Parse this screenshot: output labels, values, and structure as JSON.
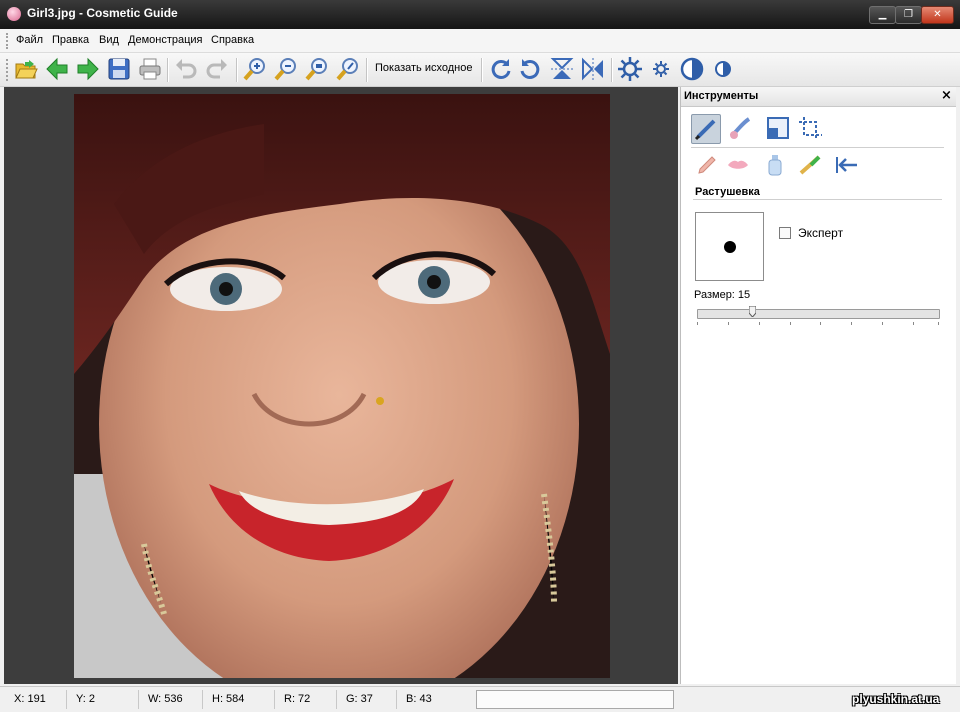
{
  "window": {
    "title": "Girl3.jpg - Cosmetic Guide"
  },
  "menu": [
    "Файл",
    "Правка",
    "Вид",
    "Демонстрация",
    "Справка"
  ],
  "toolbar": {
    "show_original_label": "Показать исходное",
    "icons": [
      "open-icon",
      "back-arrow-icon",
      "forward-arrow-icon",
      "save-icon",
      "print-icon",
      "undo-icon",
      "redo-icon",
      "zoom-in-icon",
      "zoom-out-icon",
      "zoom-fit-icon",
      "zoom-actual-icon",
      "rotate-cw-icon",
      "rotate-ccw-icon",
      "flip-vertical-icon",
      "flip-horizontal-icon",
      "brightness-increase-icon",
      "brightness-decrease-icon",
      "contrast-icon",
      "contrast-small-icon"
    ]
  },
  "tools_panel": {
    "title": "Инструменты",
    "close_label": "×",
    "top_tools": [
      "brush-icon",
      "magic-brush-icon",
      "resize-icon",
      "crop-icon"
    ],
    "second_tools": [
      "pencil-icon",
      "lips-icon",
      "bottle-icon",
      "eyeliner-icon",
      "arrow-back-icon"
    ],
    "section_title": "Растушевка",
    "expert_label": "Эксперт",
    "size_label": "Размер: 15",
    "size_value": 15
  },
  "status": {
    "x": "X: 191",
    "y": "Y: 2",
    "w": "W: 536",
    "h": "H: 584",
    "r": "R: 72",
    "g": "G: 37",
    "b": "B: 43",
    "watermark": "plyushkin.at.ua"
  },
  "colors": {
    "titlebar": "#1f1f1f",
    "accent_green": "#3fb34a",
    "canvas": "#3d3d3d",
    "lip": "#c8242b",
    "hair": "#5a1c18"
  }
}
